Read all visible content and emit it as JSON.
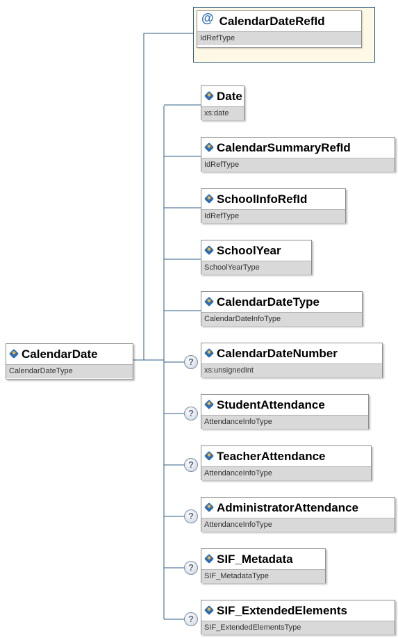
{
  "colors": {
    "connector": "#2c5d86",
    "element_icon": "#2e6db5",
    "type_bar": "#d9d9d9",
    "attribute_bg": "#fdf9e6"
  },
  "root": {
    "name": "CalendarDate",
    "type": "CalendarDateType"
  },
  "attribute": {
    "name": "CalendarDateRefId",
    "type": "IdRefType",
    "icon": "at-icon"
  },
  "optional_marker": "?",
  "children": [
    {
      "name": "Date",
      "type": "xs:date",
      "optional": false
    },
    {
      "name": "CalendarSummaryRefId",
      "type": "IdRefType",
      "optional": false
    },
    {
      "name": "SchoolInfoRefId",
      "type": "IdRefType",
      "optional": false
    },
    {
      "name": "SchoolYear",
      "type": "SchoolYearType",
      "optional": false
    },
    {
      "name": "CalendarDateType",
      "type": "CalendarDateInfoType",
      "optional": false
    },
    {
      "name": "CalendarDateNumber",
      "type": "xs:unsignedInt",
      "optional": true
    },
    {
      "name": "StudentAttendance",
      "type": "AttendanceInfoType",
      "optional": true
    },
    {
      "name": "TeacherAttendance",
      "type": "AttendanceInfoType",
      "optional": true
    },
    {
      "name": "AdministratorAttendance",
      "type": "AttendanceInfoType",
      "optional": true
    },
    {
      "name": "SIF_Metadata",
      "type": "SIF_MetadataType",
      "optional": true
    },
    {
      "name": "SIF_ExtendedElements",
      "type": "SIF_ExtendedElementsType",
      "optional": true
    }
  ]
}
